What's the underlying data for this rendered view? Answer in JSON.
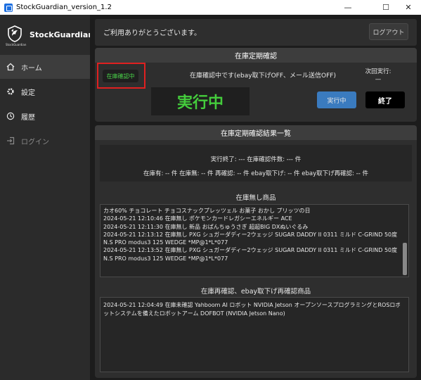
{
  "window": {
    "title": "StockGuardian_version_1.2",
    "minimize_glyph": "—",
    "maximize_glyph": "☐",
    "close_glyph": "✕"
  },
  "sidebar": {
    "brand_name": "StockGuardian",
    "logo_caption": "StockGuardian",
    "items": [
      {
        "label": "ホーム",
        "icon": "home-icon",
        "active": true
      },
      {
        "label": "設定",
        "icon": "gear-icon"
      },
      {
        "label": "履歴",
        "icon": "history-icon"
      },
      {
        "label": "ログイン",
        "icon": "login-icon",
        "disabled": true
      }
    ]
  },
  "topbar": {
    "thanks_text": "ご利用ありがとうございます。",
    "logout_label": "ログアウト"
  },
  "check_panel": {
    "header": "在庫定期確認",
    "badge_label": "在庫確認中",
    "status_text": "在庫確認中です(ebay取下げOFF、メール送信OFF)",
    "next_run_label": "次回実行:",
    "next_run_value": "—",
    "running_display": "実行中",
    "run_button": "実行中",
    "end_button": "終了"
  },
  "results_panel": {
    "header": "在庫定期確認結果一覧",
    "summary_line1": "実行終了: ---   在庫確認件数: --- 件",
    "summary_line2": "在庫有: -- 件  在庫無: -- 件  再確認: -- 件  ebay取下げ: -- 件  ebay取下げ再確認: -- 件",
    "out_of_stock_title": "在庫無し商品",
    "out_of_stock_lines": [
      "カオ60% チョコレート チョコスナックプレッツェル お菓子 おかし プリッツの日",
      "2024-05-21 12:10:46  在庫無し  ポケモンカードレガシーエネルギー ACE",
      "2024-05-21 12:11:30  在庫無し  新品  おぱんちゅうさぎ  超超BIG  DXぬいぐるみ",
      "2024-05-21 12:13:12  在庫無し  PXG シュガーダディー2ウェッジ SUGAR DADDY II 0311 ミルド C-GRIND 50度",
      "N.S PRO modus3 125 WEDGE *MP@1*L*077",
      "2024-05-21 12:13:52  在庫無し  PXG シュガーダディー2ウェッジ SUGAR DADDY II 0311 ミルド C-GRIND 50度",
      "N.S PRO modus3 125 WEDGE *MP@1*L*077"
    ],
    "recheck_title": "在庫再確認、ebay取下げ再確認商品",
    "recheck_lines": [
      "2024-05-21 12:04:49  在庫未確認  Yahboom AI ロボット NVIDIA Jetson オープンソースプログラミングとROSロボ",
      "ットシステムを備えたロボットアーム DOFBOT (NVIDIA Jetson Nano)"
    ]
  },
  "colors": {
    "accent_blue": "#3a7bbf",
    "running_green": "#44cc3c",
    "highlight_red": "#e02020"
  }
}
